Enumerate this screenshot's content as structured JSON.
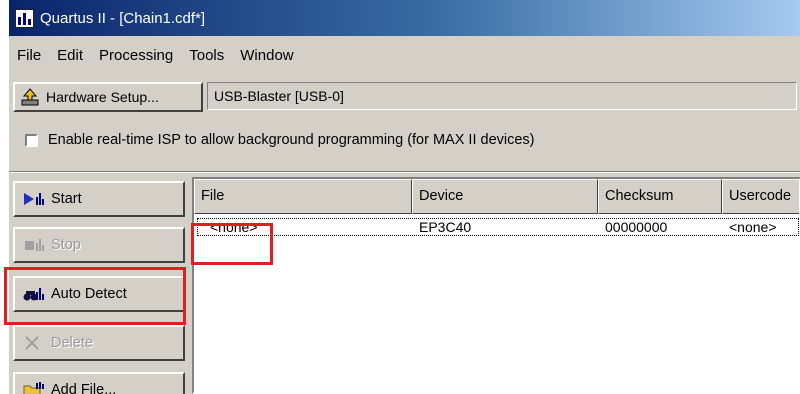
{
  "window": {
    "title": "Quartus II - [Chain1.cdf*]",
    "title_gradient": [
      "#0a246a",
      "#a6caf0"
    ]
  },
  "menu": [
    {
      "label": "File"
    },
    {
      "label": "Edit"
    },
    {
      "label": "Processing"
    },
    {
      "label": "Tools"
    },
    {
      "label": "Window"
    }
  ],
  "toolbar": {
    "hardware_setup_label": "Hardware Setup...",
    "hardware_value": "USB-Blaster [USB-0]"
  },
  "isp": {
    "label": "Enable real-time ISP to allow background programming (for MAX II devices)",
    "checked": false
  },
  "side_buttons": [
    {
      "label": "Start",
      "enabled": true,
      "icon": "start-icon"
    },
    {
      "label": "Stop",
      "enabled": false,
      "icon": "stop-icon"
    },
    {
      "label": "Auto Detect",
      "enabled": true,
      "icon": "auto-detect-icon"
    },
    {
      "label": "Delete",
      "enabled": false,
      "icon": "delete-icon"
    },
    {
      "label": "Add File...",
      "enabled": true,
      "icon": "add-file-icon"
    }
  ],
  "table": {
    "headers": [
      "File",
      "Device",
      "Checksum",
      "Usercode"
    ],
    "rows": [
      {
        "file": "<none>",
        "device": "EP3C40",
        "checksum": "00000000",
        "usercode": "<none>"
      }
    ]
  },
  "highlight_color": "#e02020"
}
